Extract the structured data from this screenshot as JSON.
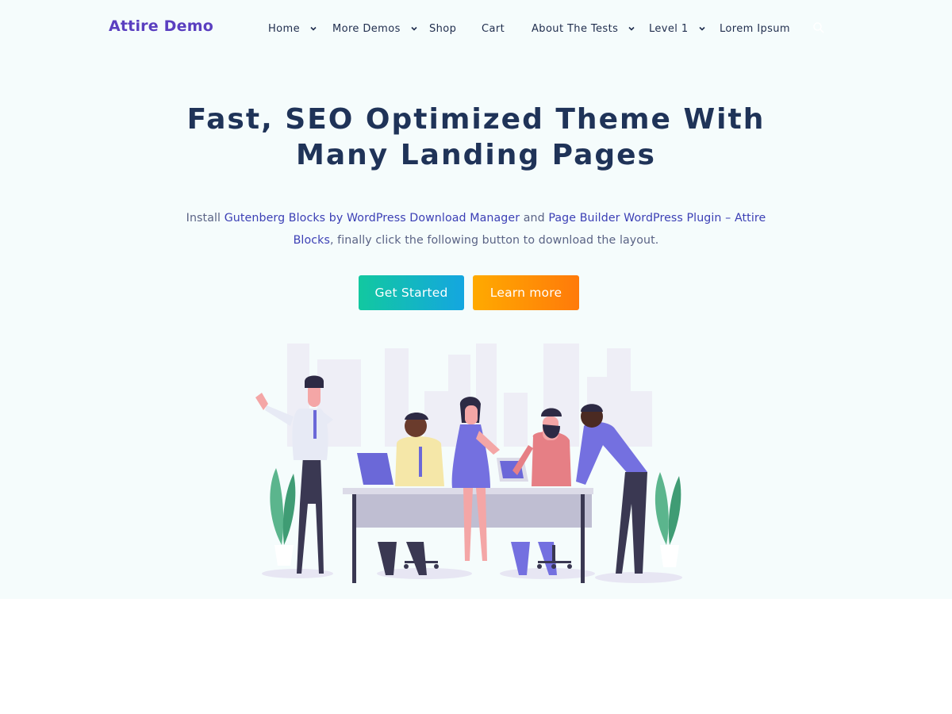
{
  "header": {
    "logo": "Attire Demo",
    "nav": [
      {
        "label": "Home",
        "has_dropdown": true
      },
      {
        "label": "More Demos",
        "has_dropdown": true
      },
      {
        "label": "Shop",
        "has_dropdown": false
      },
      {
        "label": "Cart",
        "has_dropdown": false
      },
      {
        "label": "About The Tests",
        "has_dropdown": true
      },
      {
        "label": "Level 1",
        "has_dropdown": true
      },
      {
        "label": "Lorem Ipsum",
        "has_dropdown": false
      }
    ],
    "search_icon": "search-icon"
  },
  "hero": {
    "headline_line1": "Fast, SEO Optimized Theme With",
    "headline_line2": "Many Landing Pages",
    "intro": {
      "t1": "Install ",
      "link1": "Gutenberg Blocks by WordPress Download Manager",
      "t2": " and ",
      "link2": "Page Builder WordPress Plugin – Attire Blocks",
      "t3": ", finally click the following button to download the layout."
    },
    "primary_button": "Get Started",
    "secondary_button": "Learn more"
  },
  "colors": {
    "brand": "#5a3fc0",
    "heading": "#1f3358",
    "link": "#3b3fb5",
    "hero_background": "#f5fcfc",
    "primary_gradient": [
      "#12c8a0",
      "#14a6e0"
    ],
    "secondary_gradient": [
      "#ffaa00",
      "#ff7a0a"
    ]
  }
}
